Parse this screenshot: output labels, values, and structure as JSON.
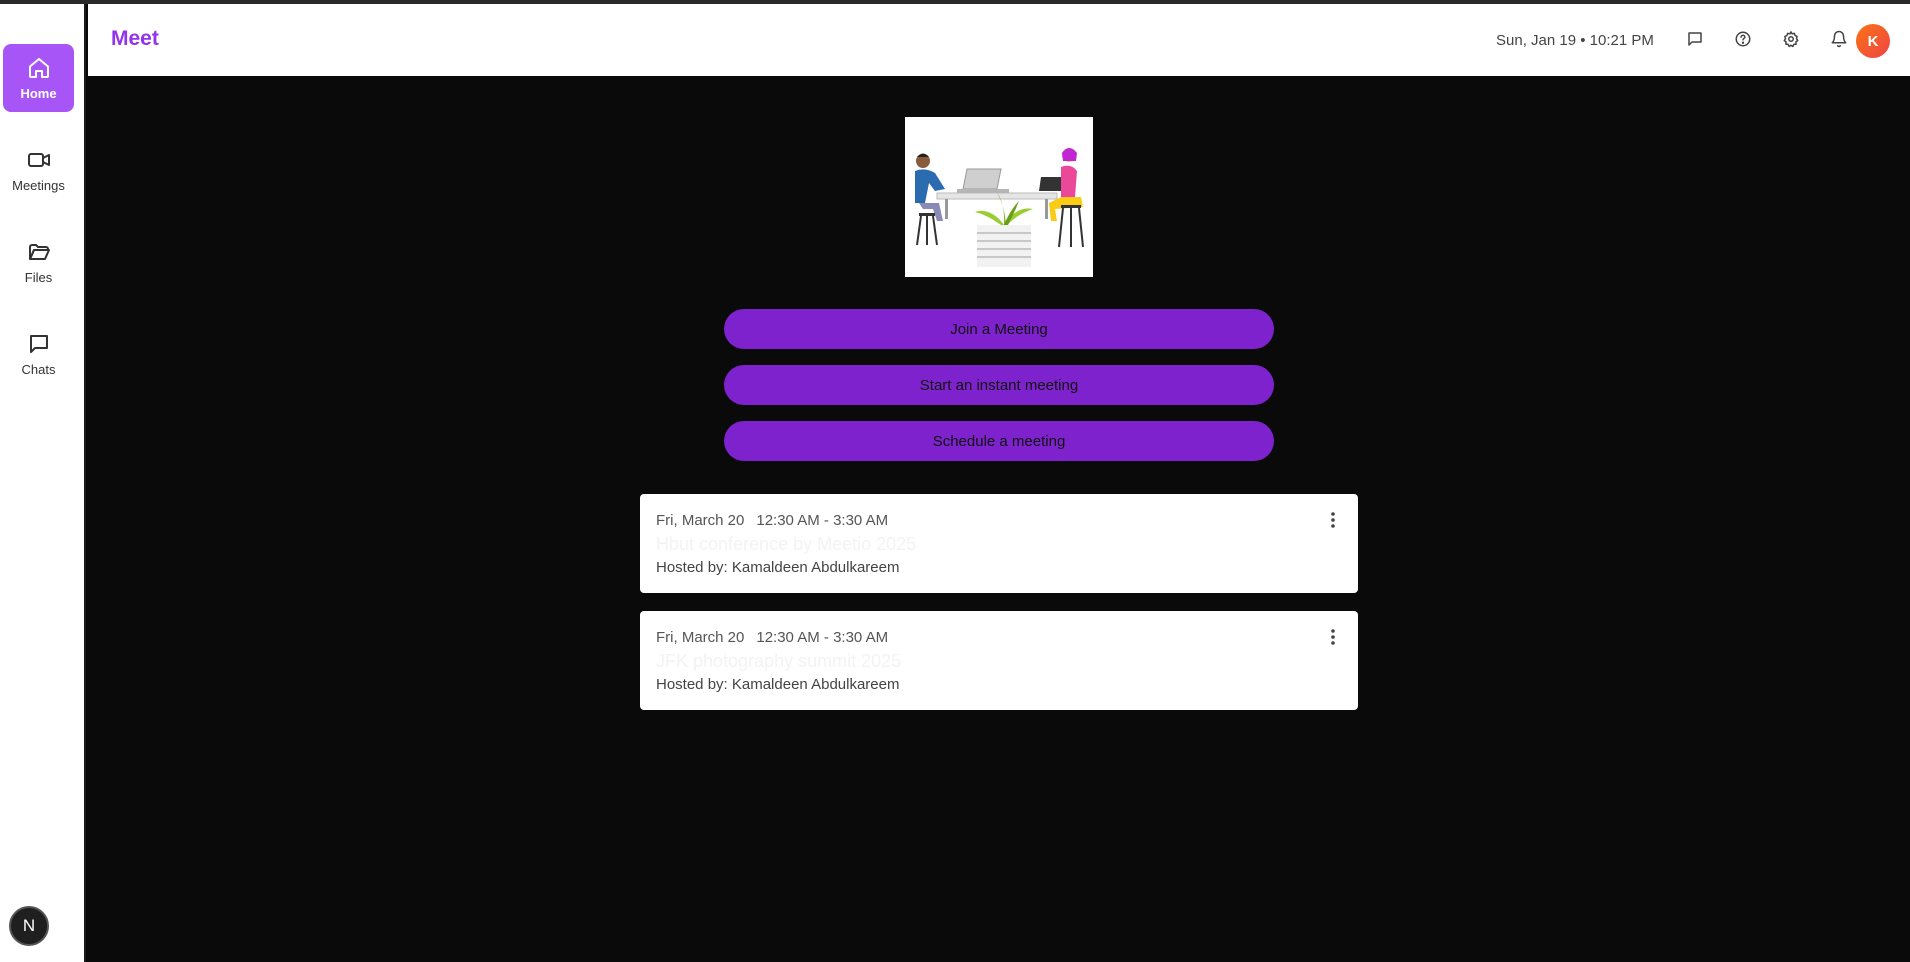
{
  "app": {
    "title": "Meet"
  },
  "sidebar": {
    "items": [
      {
        "label": "Home",
        "icon": "home-icon",
        "active": true
      },
      {
        "label": "Meetings",
        "icon": "video-icon"
      },
      {
        "label": "Files",
        "icon": "folder-icon"
      },
      {
        "label": "Chats",
        "icon": "chat-icon"
      }
    ],
    "badge": "N"
  },
  "header": {
    "datetime": "Sun, Jan 19 • 10:21 PM",
    "avatar_initial": "K"
  },
  "actions": {
    "join": "Join a Meeting",
    "instant": "Start an instant meeting",
    "schedule": "Schedule a meeting"
  },
  "meetings": [
    {
      "date": "Fri, March 20",
      "time": "12:30 AM - 3:30 AM",
      "title": "Hbut conference by Meetio 2025",
      "host": "Hosted by: Kamaldeen Abdulkareem"
    },
    {
      "date": "Fri, March 20",
      "time": "12:30 AM - 3:30 AM",
      "title": "JFK photography summit 2025",
      "host": "Hosted by: Kamaldeen Abdulkareem"
    }
  ],
  "colors": {
    "accent": "#a855f7",
    "button": "#7e22ce",
    "brand": "#9333ea",
    "avatar": "#ef4444",
    "background": "#0a0a0a"
  }
}
